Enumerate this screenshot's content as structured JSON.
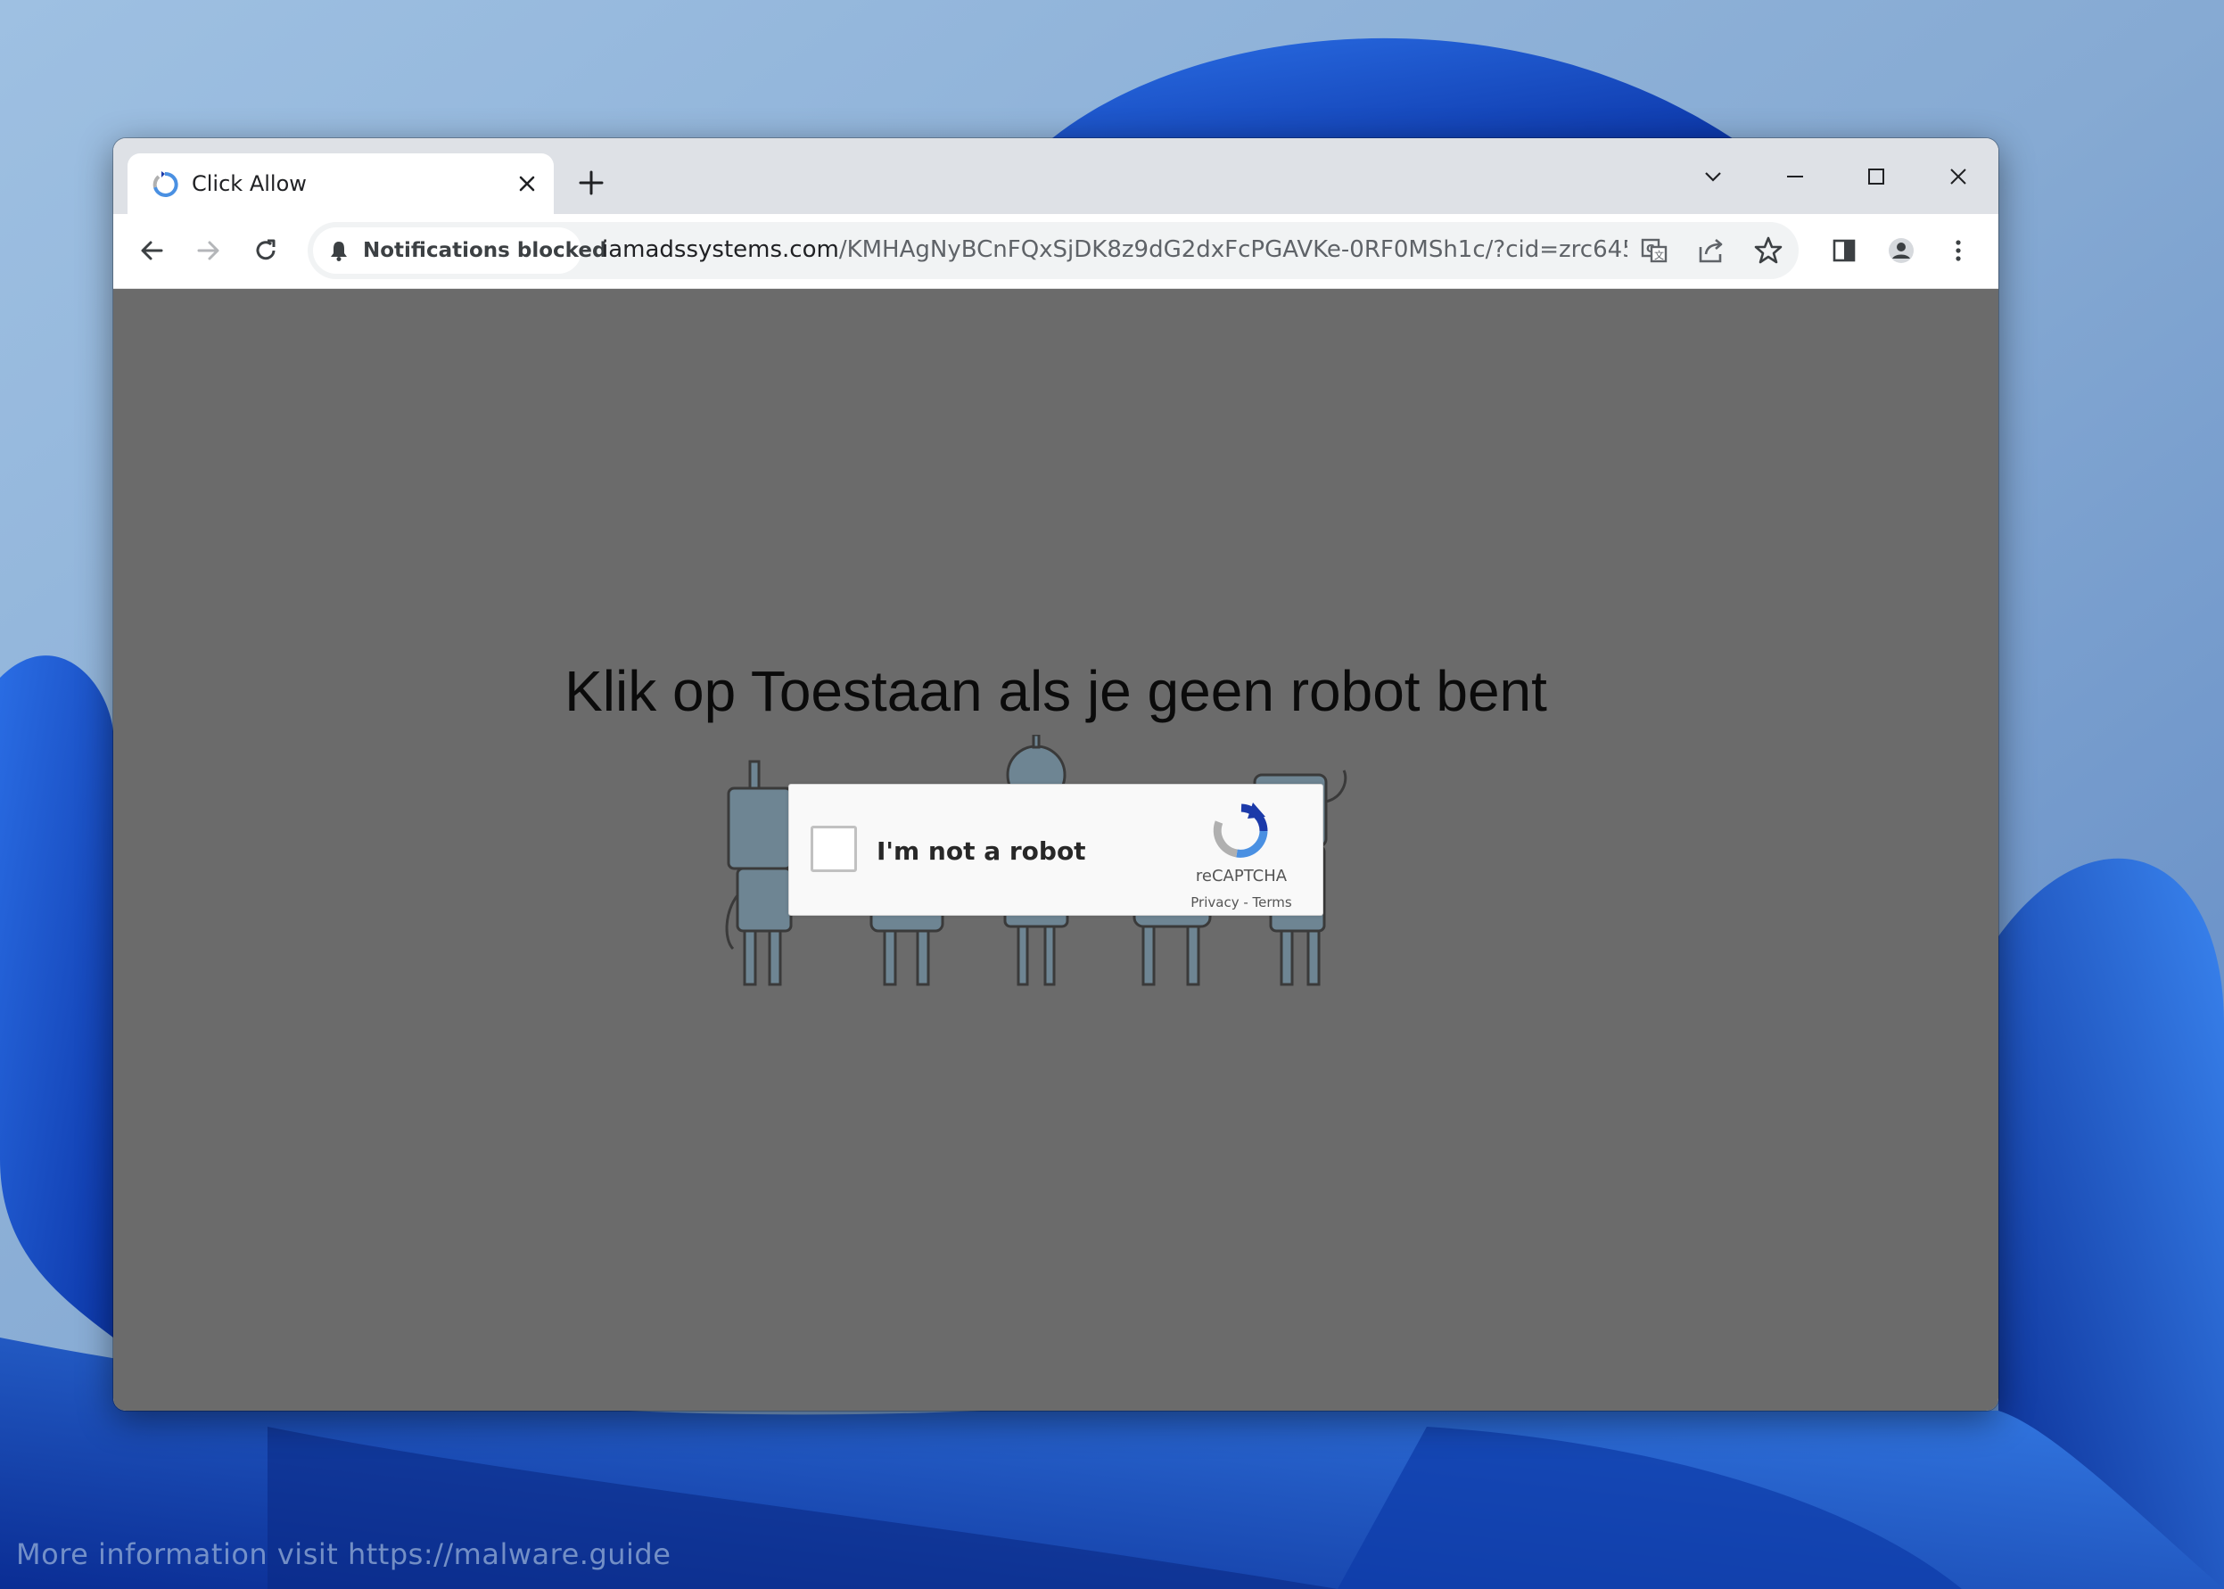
{
  "browser": {
    "tab": {
      "title": "Click Allow"
    },
    "address_bar": {
      "permission_chip": "Notifications blocked",
      "url_host": "iamadssystems.com",
      "url_path": "/KMHAgNyBCnFQxSjDK8z9dG2dxFcPGAVKe-0RF0MSh1c/?cid=zrc6454..."
    }
  },
  "page": {
    "headline": "Klik op Toestaan als je geen robot bent",
    "captcha": {
      "label": "I'm not a robot",
      "brand": "reCAPTCHA",
      "privacy": "Privacy",
      "separator": " - ",
      "terms": "Terms"
    }
  },
  "watermark": "More information visit https://malware.guide",
  "icons": {
    "tab_favicon": "recaptcha-icon",
    "permission": "bell-icon",
    "toolbar": [
      "back-icon",
      "forward-icon",
      "reload-icon",
      "translate-icon",
      "share-icon",
      "star-icon",
      "side-panel-icon",
      "profile-icon",
      "menu-icon"
    ],
    "window": [
      "tab-search-icon",
      "minimize-icon",
      "maximize-icon",
      "close-icon"
    ]
  },
  "colors": {
    "page_background": "#6b6b6b",
    "headline": "#0b0b0b",
    "browser_chrome": "#dee1e6",
    "wallpaper": "#1f4fbf"
  }
}
